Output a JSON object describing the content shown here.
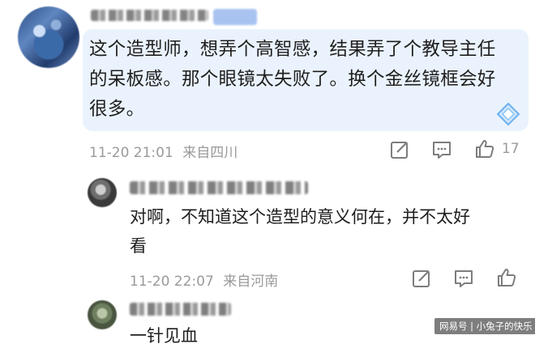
{
  "main_comment": {
    "text": "这个造型师，想弄个高智感，结果弄了个教导主任\n的呆板感。那个眼镜太失败了。换个金丝镜框会好\n很多。",
    "time": "11-20 21:01",
    "location": "来自四川",
    "like_count": "17"
  },
  "reply_1": {
    "text": "对啊，不知道这个造型的意义何在，并不太好\n看",
    "time": "11-20 22:07",
    "location": "来自河南"
  },
  "reply_2": {
    "text_partial": "一针见血"
  },
  "watermark": "网易号 | 小兔子的快乐",
  "icons": [
    "edit-icon",
    "comment-icon",
    "like-icon",
    "diamond-icon"
  ],
  "colors": {
    "bubble": "#eaf3fd",
    "meta_text": "#9a9a9a",
    "icon_stroke": "#7d7d7d"
  }
}
